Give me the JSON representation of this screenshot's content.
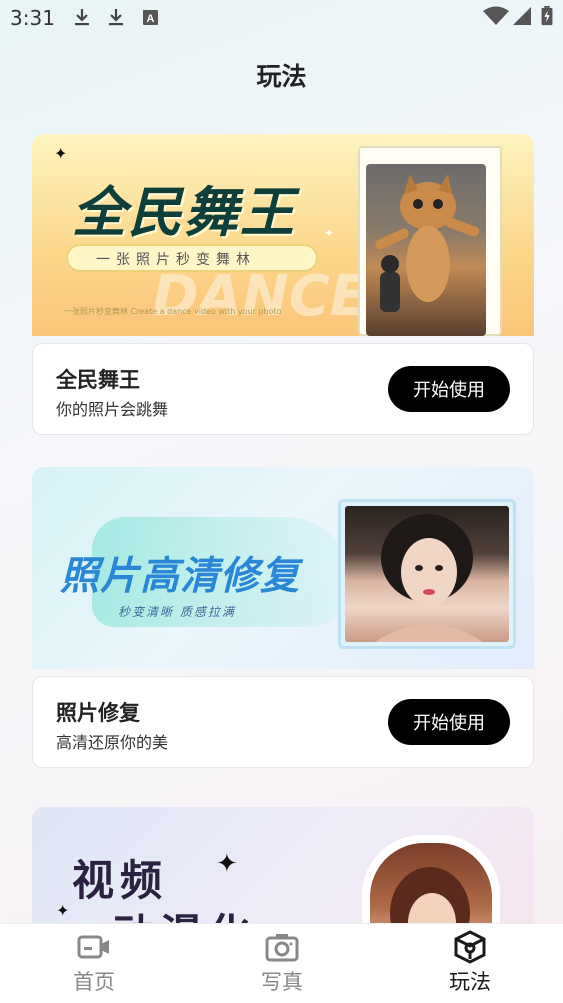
{
  "status_bar": {
    "time": "3:31",
    "icons": [
      "download-icon",
      "download-icon",
      "text-a-icon"
    ],
    "right_icons": [
      "wifi-icon",
      "signal-icon",
      "battery-icon"
    ]
  },
  "header": {
    "title": "玩法"
  },
  "cards": [
    {
      "banner": {
        "title": "全民舞王",
        "subtitle": "一张照片秒变舞林",
        "bg_text": "DANCE",
        "fine_print": "一张照片秒变舞林 Create a dance video with your photo"
      },
      "title": "全民舞王",
      "subtitle": "你的照片会跳舞",
      "button_label": "开始使用"
    },
    {
      "banner": {
        "title": "照片高清修复",
        "subtitle": "秒变清晰  质感拉满"
      },
      "title": "照片修复",
      "subtitle": "高清还原你的美",
      "button_label": "开始使用"
    },
    {
      "banner": {
        "title_line1": "视频",
        "title_line2": "动漫化"
      }
    }
  ],
  "tab_bar": {
    "tabs": [
      {
        "label": "首页",
        "icon": "video-camera-icon",
        "active": false
      },
      {
        "label": "写真",
        "icon": "camera-icon",
        "active": false
      },
      {
        "label": "玩法",
        "icon": "cube-icon",
        "active": true
      }
    ]
  },
  "colors": {
    "accent": "#000000",
    "active_tab": "#1a1a1a",
    "inactive_tab": "#888888"
  }
}
